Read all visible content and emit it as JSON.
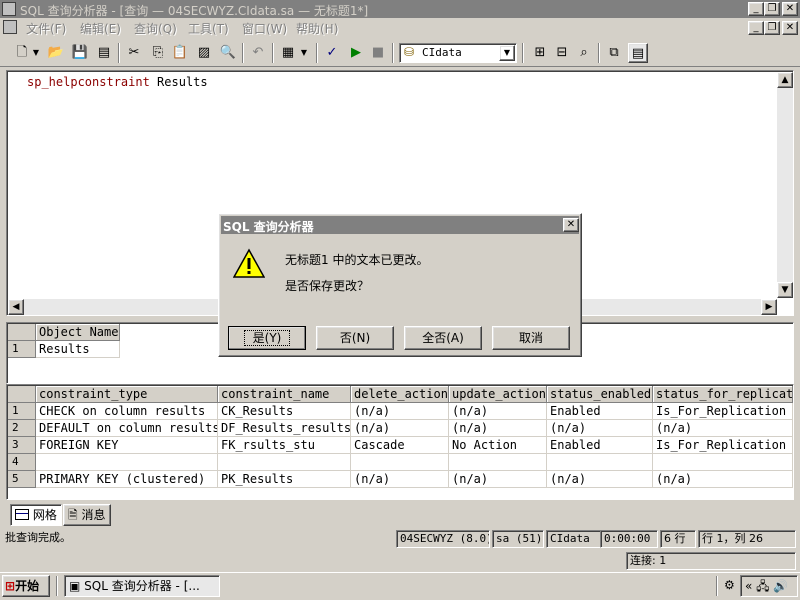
{
  "window": {
    "title": "SQL 查询分析器 - [查询 — 04SECWYZ.CIdata.sa — 无标题1*]"
  },
  "menu": [
    "文件(F)",
    "编辑(E)",
    "查询(Q)",
    "工具(T)",
    "窗口(W)",
    "帮助(H)"
  ],
  "toolbar": {
    "database": "CIdata"
  },
  "editor": {
    "code_keyword": "sp_helpconstraint",
    "code_arg": " Results"
  },
  "result1": {
    "header": "Object Name",
    "rows": [
      {
        "num": "1",
        "value": "Results"
      }
    ]
  },
  "result2": {
    "columns": [
      "constraint_type",
      "constraint_name",
      "delete_action",
      "update_action",
      "status_enabled",
      "status_for_replicati"
    ],
    "rows": [
      {
        "num": "1",
        "cells": [
          "CHECK on column results",
          "CK_Results",
          "(n/a)",
          "(n/a)",
          "Enabled",
          "Is_For_Replication"
        ]
      },
      {
        "num": "2",
        "cells": [
          "DEFAULT on column results",
          "DF_Results_results",
          "(n/a)",
          "(n/a)",
          "(n/a)",
          "(n/a)"
        ]
      },
      {
        "num": "3",
        "cells": [
          "FOREIGN KEY",
          "FK_rsults_stu",
          "Cascade",
          "No Action",
          "Enabled",
          "Is_For_Replication"
        ]
      },
      {
        "num": "4",
        "cells": [
          "",
          "",
          "",
          "",
          "",
          ""
        ]
      },
      {
        "num": "5",
        "cells": [
          "PRIMARY KEY (clustered)",
          "PK_Results",
          "(n/a)",
          "(n/a)",
          "(n/a)",
          "(n/a)"
        ]
      }
    ]
  },
  "tabs": {
    "grid": "网格",
    "messages": "消息"
  },
  "dialog": {
    "title": "SQL 查询分析器",
    "message1": "无标题1 中的文本已更改。",
    "message2": "是否保存更改？",
    "btn_yes": "是(Y)",
    "btn_no": "否(N)",
    "btn_no_all": "全否(A)",
    "btn_cancel": "取消"
  },
  "status": {
    "message": "批查询完成。",
    "server": "04SECWYZ (8.0)",
    "user": "sa (51)",
    "database": "CIdata",
    "time": "0:00:00",
    "rows": "6 行",
    "position": "行 1，列 26",
    "connections": "连接: 1"
  },
  "taskbar": {
    "start": "开始",
    "task": "SQL 查询分析器 - [..."
  }
}
